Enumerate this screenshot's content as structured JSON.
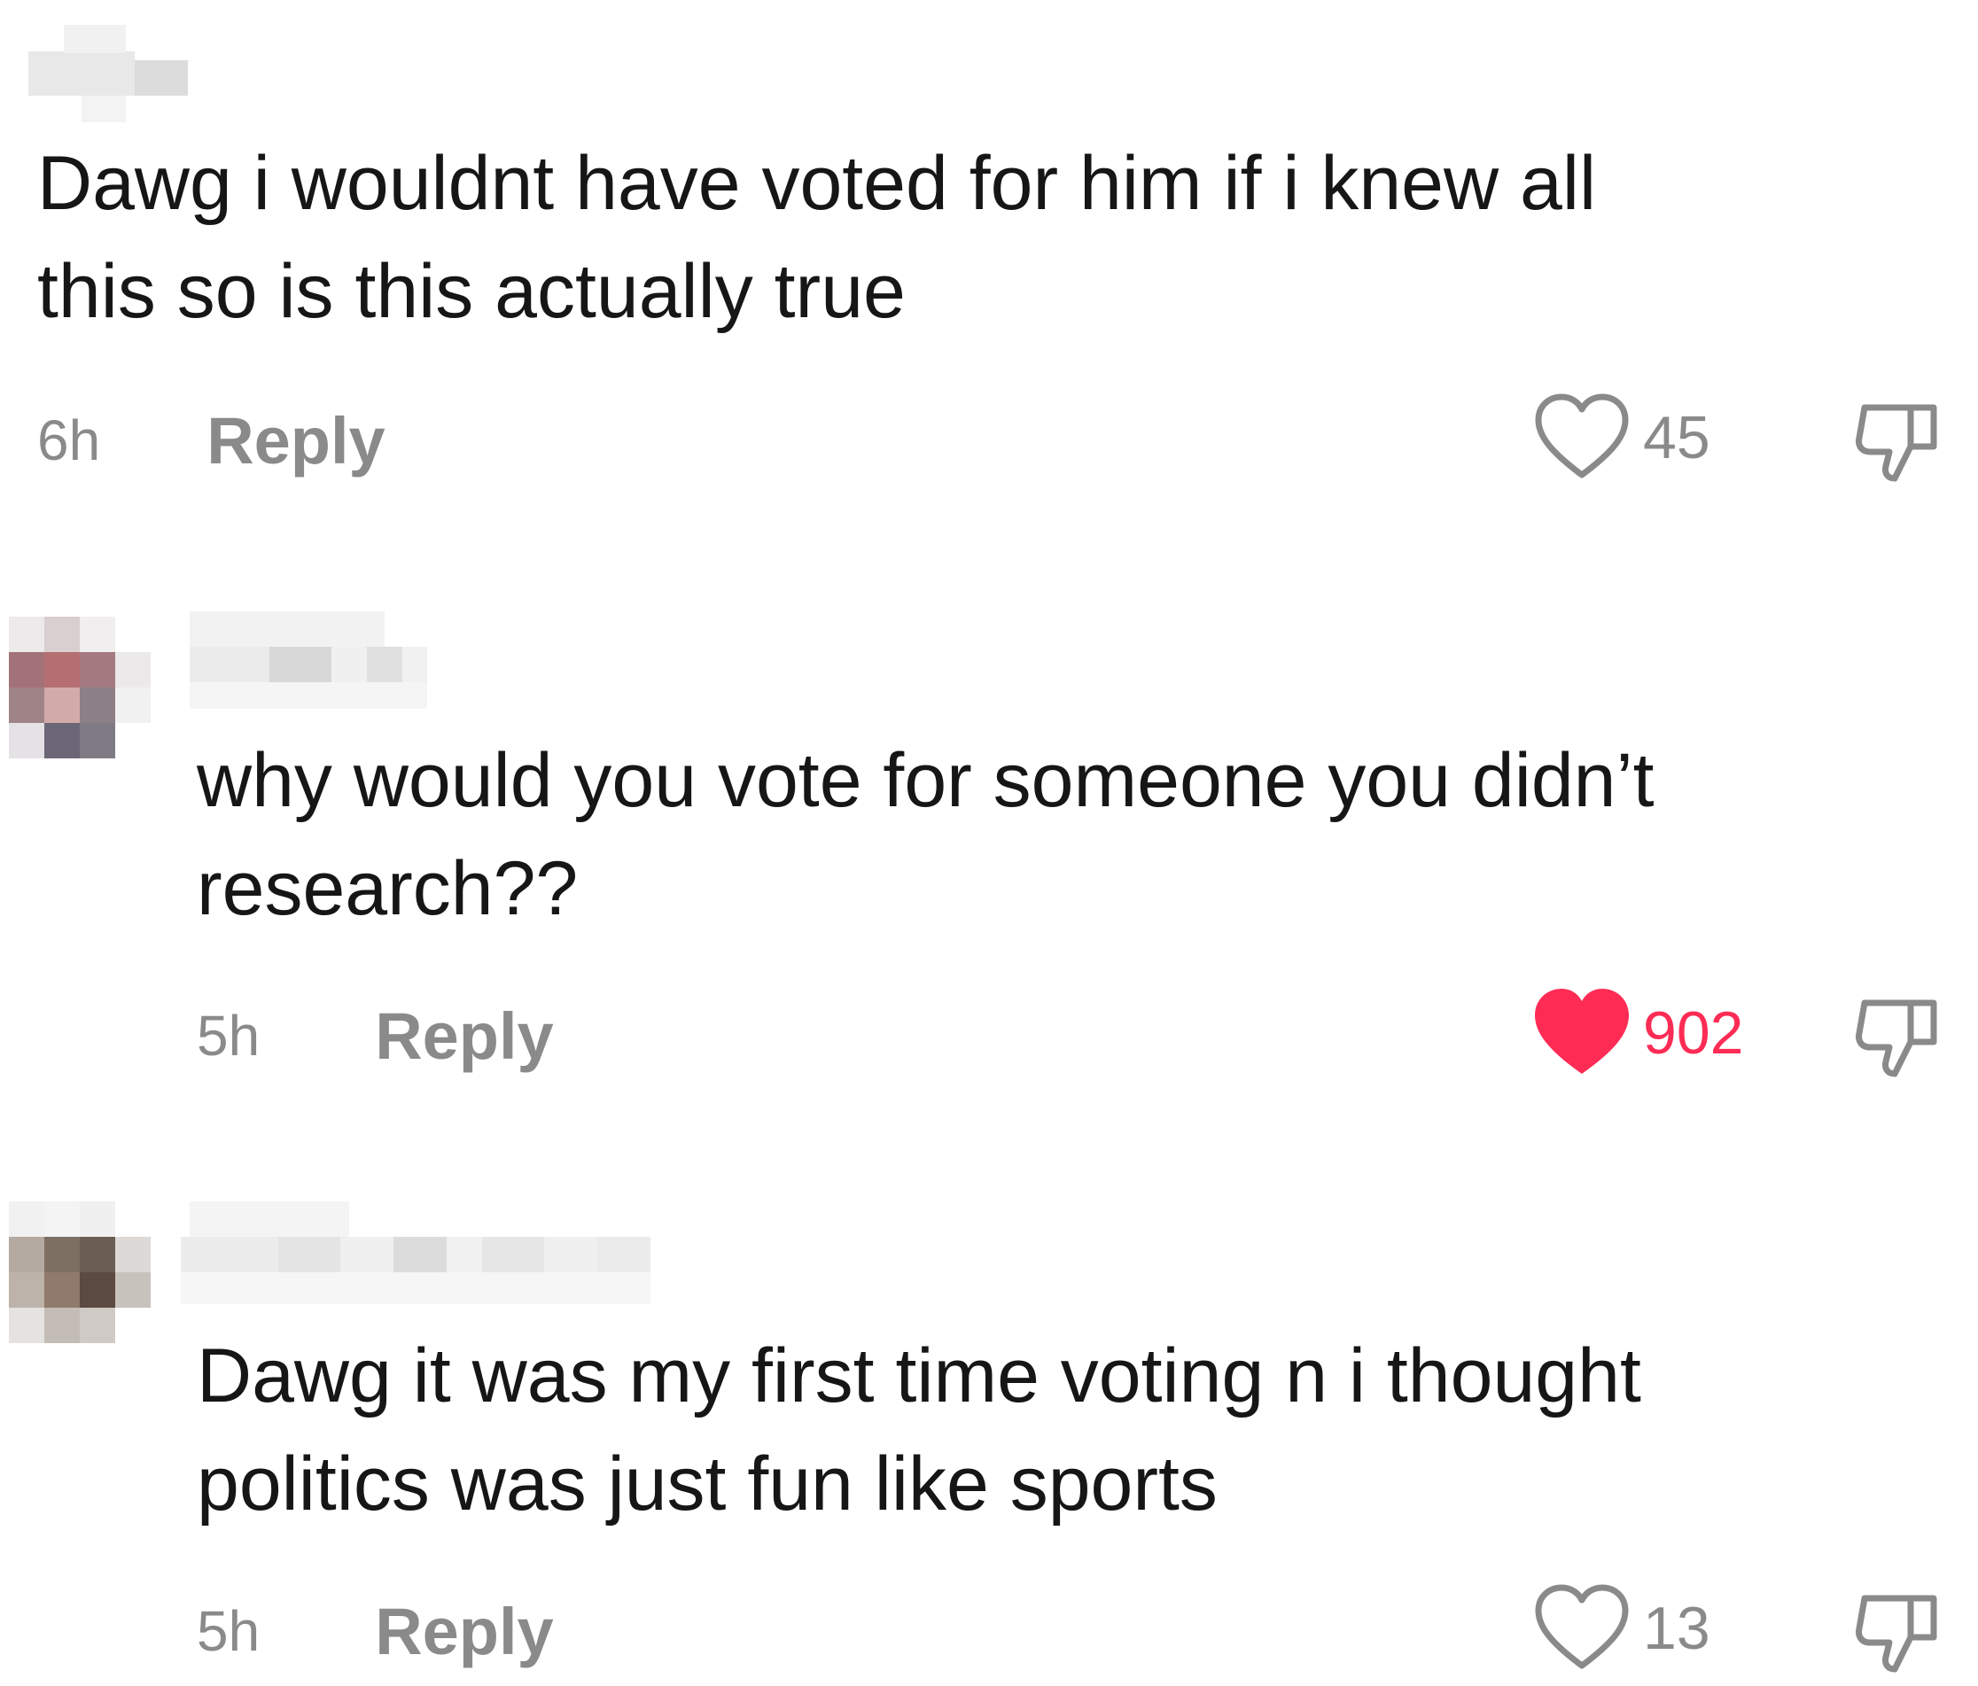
{
  "colors": {
    "text": "#161616",
    "muted": "#8a8a8a",
    "like_active": "#fe2c55",
    "background": "#ffffff"
  },
  "comments": [
    {
      "text_lines": [
        "Dawg i wouldnt have voted for him if i knew all",
        "this so is this actually true"
      ],
      "time": "6h",
      "reply_label": "Reply",
      "likes": "45",
      "liked": false,
      "avatar_visible": false,
      "username_redacted": true
    },
    {
      "text_lines": [
        "why would you vote for someone you didn’t",
        "research??"
      ],
      "time": "5h",
      "reply_label": "Reply",
      "likes": "902",
      "liked": true,
      "avatar_visible": true,
      "username_redacted": true
    },
    {
      "text_lines": [
        "Dawg it was my first time voting n i thought",
        "politics was just fun like sports"
      ],
      "time": "5h",
      "reply_label": "Reply",
      "likes": "13",
      "liked": false,
      "avatar_visible": true,
      "username_redacted": true
    }
  ],
  "icons": {
    "like": "heart-icon",
    "dislike": "thumbs-down-icon",
    "avatar": "pixelated-avatar"
  }
}
